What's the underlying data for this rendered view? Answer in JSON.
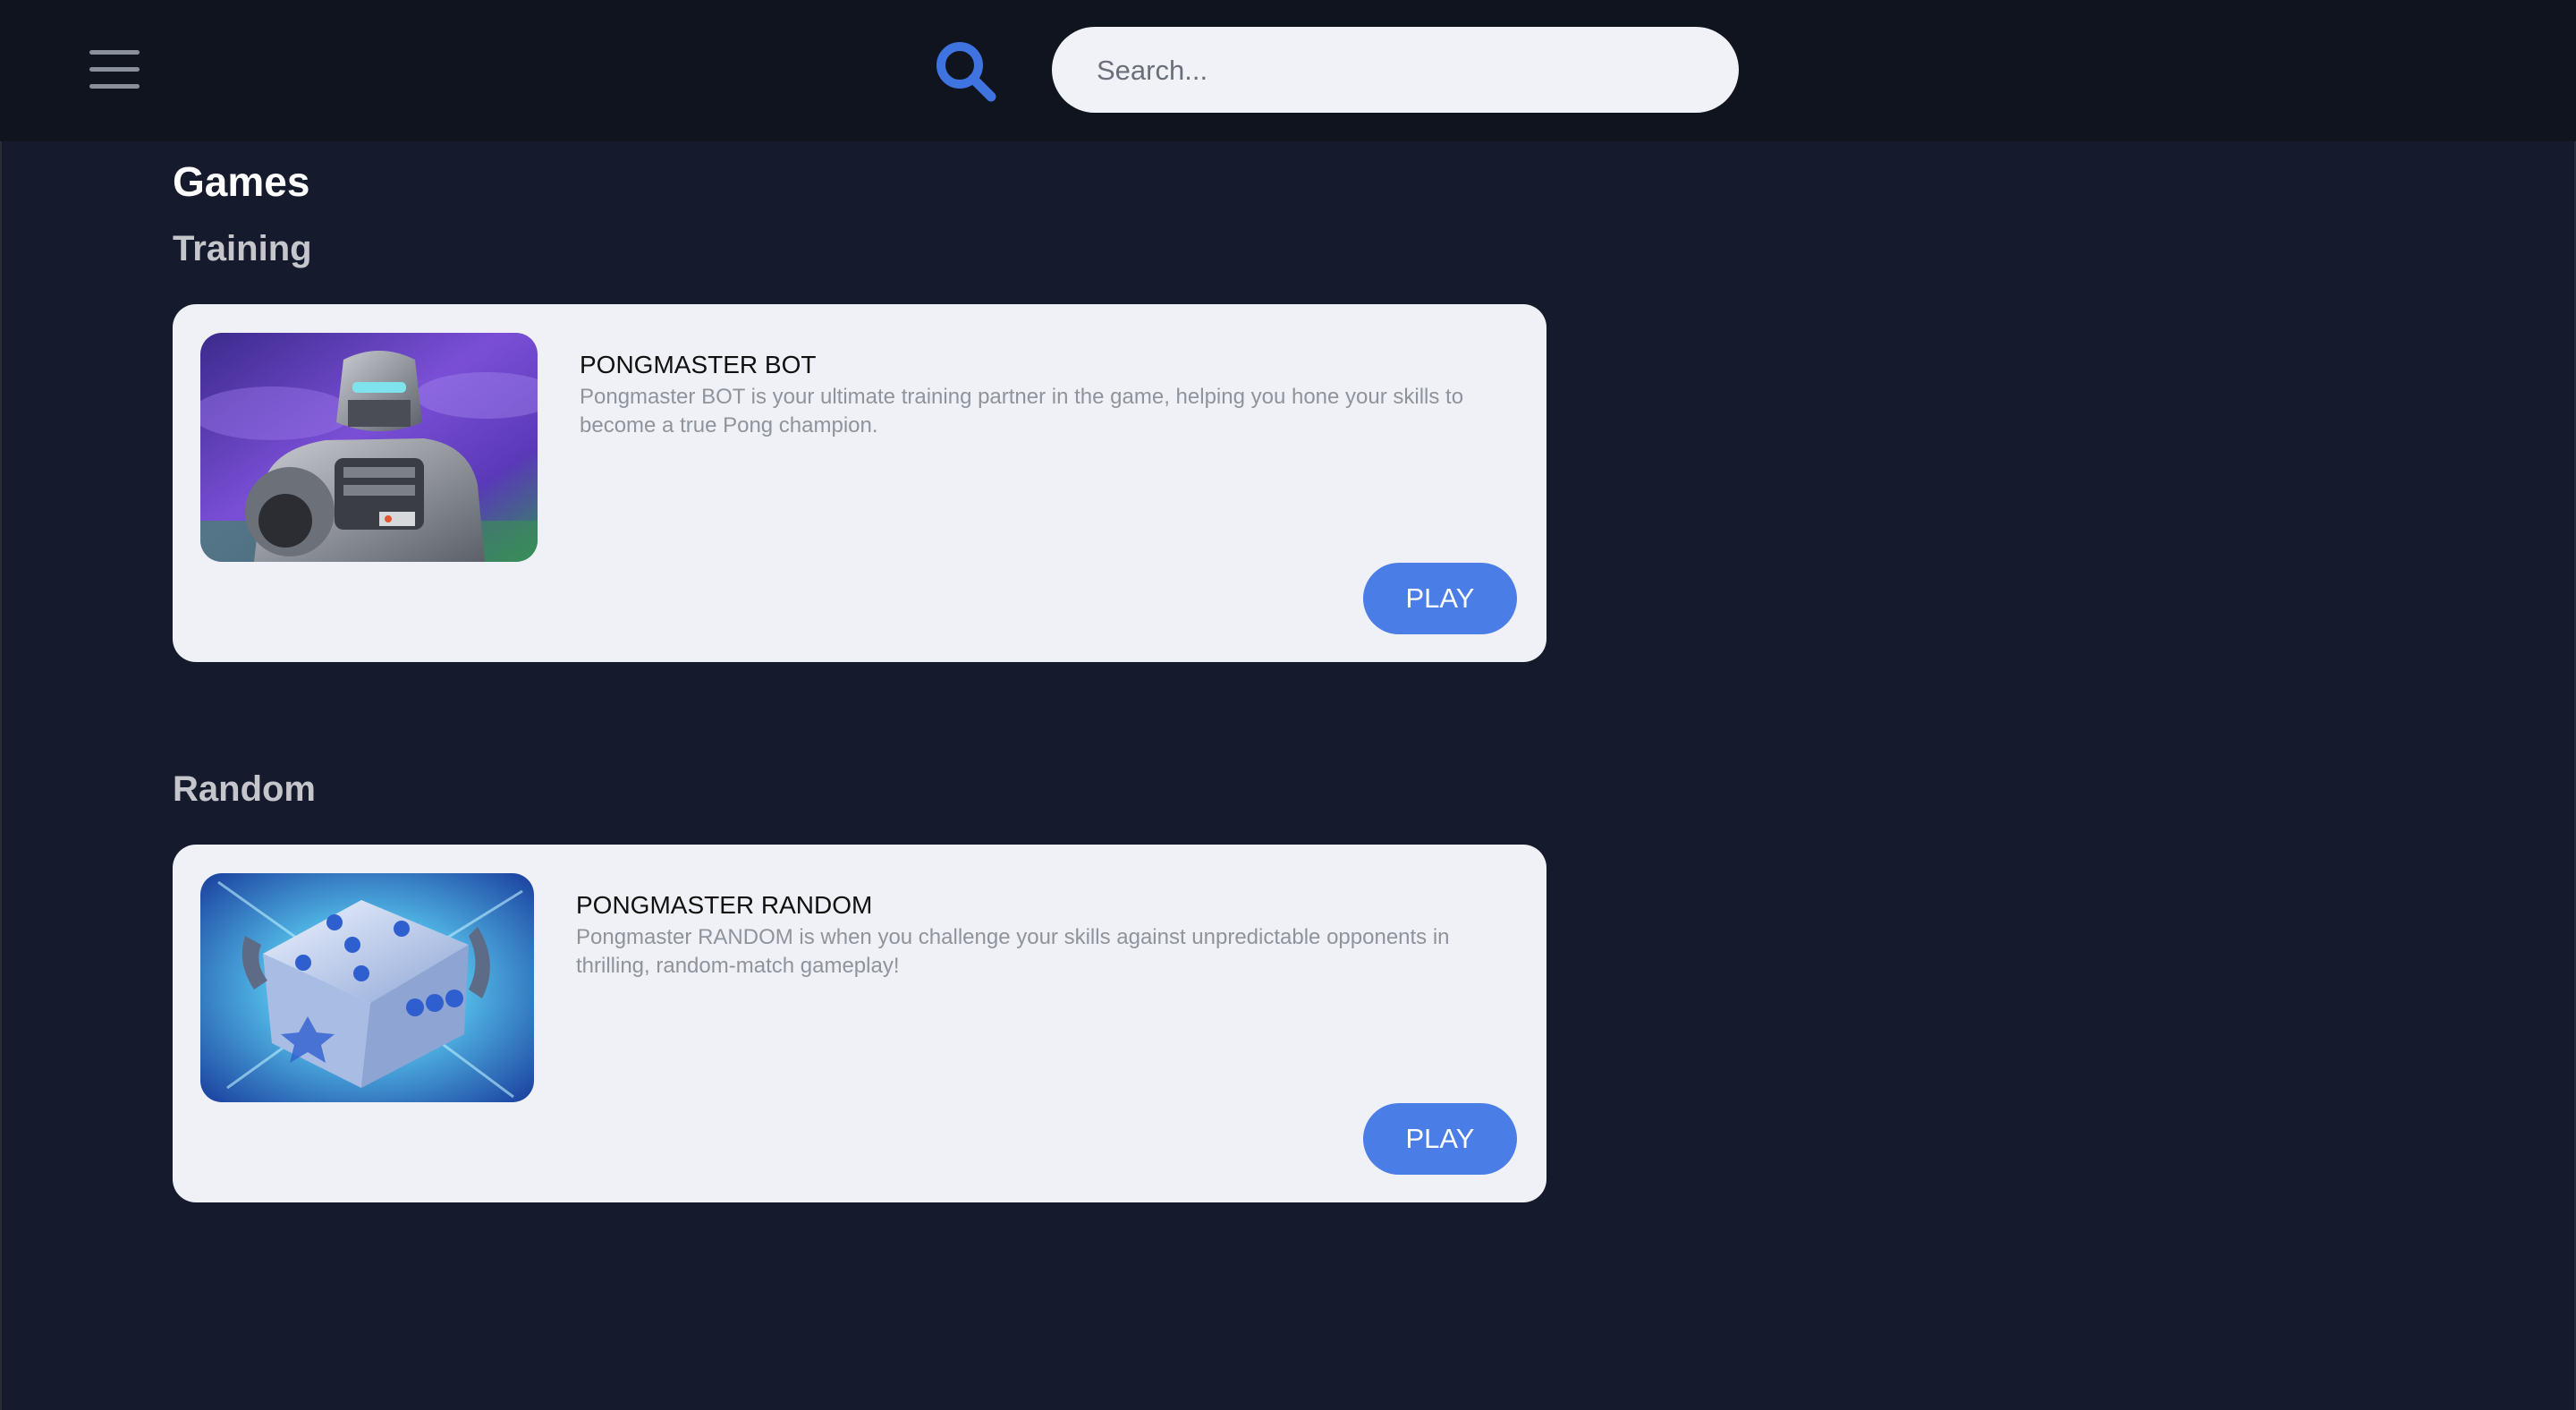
{
  "header": {
    "menu_icon": "hamburger-menu-icon",
    "search_icon": "search-icon",
    "search_placeholder": "Search...",
    "search_value": ""
  },
  "page": {
    "title": "Games"
  },
  "sections": [
    {
      "title": "Training",
      "card": {
        "image_icon": "robot-image",
        "name": "PONGMASTER BOT",
        "description": "Pongmaster BOT is your ultimate training partner in the game, helping you hone your skills to become a true Pong champion.",
        "button_label": "PLAY"
      }
    },
    {
      "title": "Random",
      "card": {
        "image_icon": "dice-image",
        "name": "PONGMASTER RANDOM",
        "description": "Pongmaster RANDOM is when you challenge your skills against unpredictable opponents in thrilling, random-match gameplay!",
        "button_label": "PLAY"
      }
    }
  ],
  "colors": {
    "background": "#151b2c",
    "topbar": "#10141f",
    "card": "#f0f1f7",
    "accent": "#4a7de6"
  }
}
